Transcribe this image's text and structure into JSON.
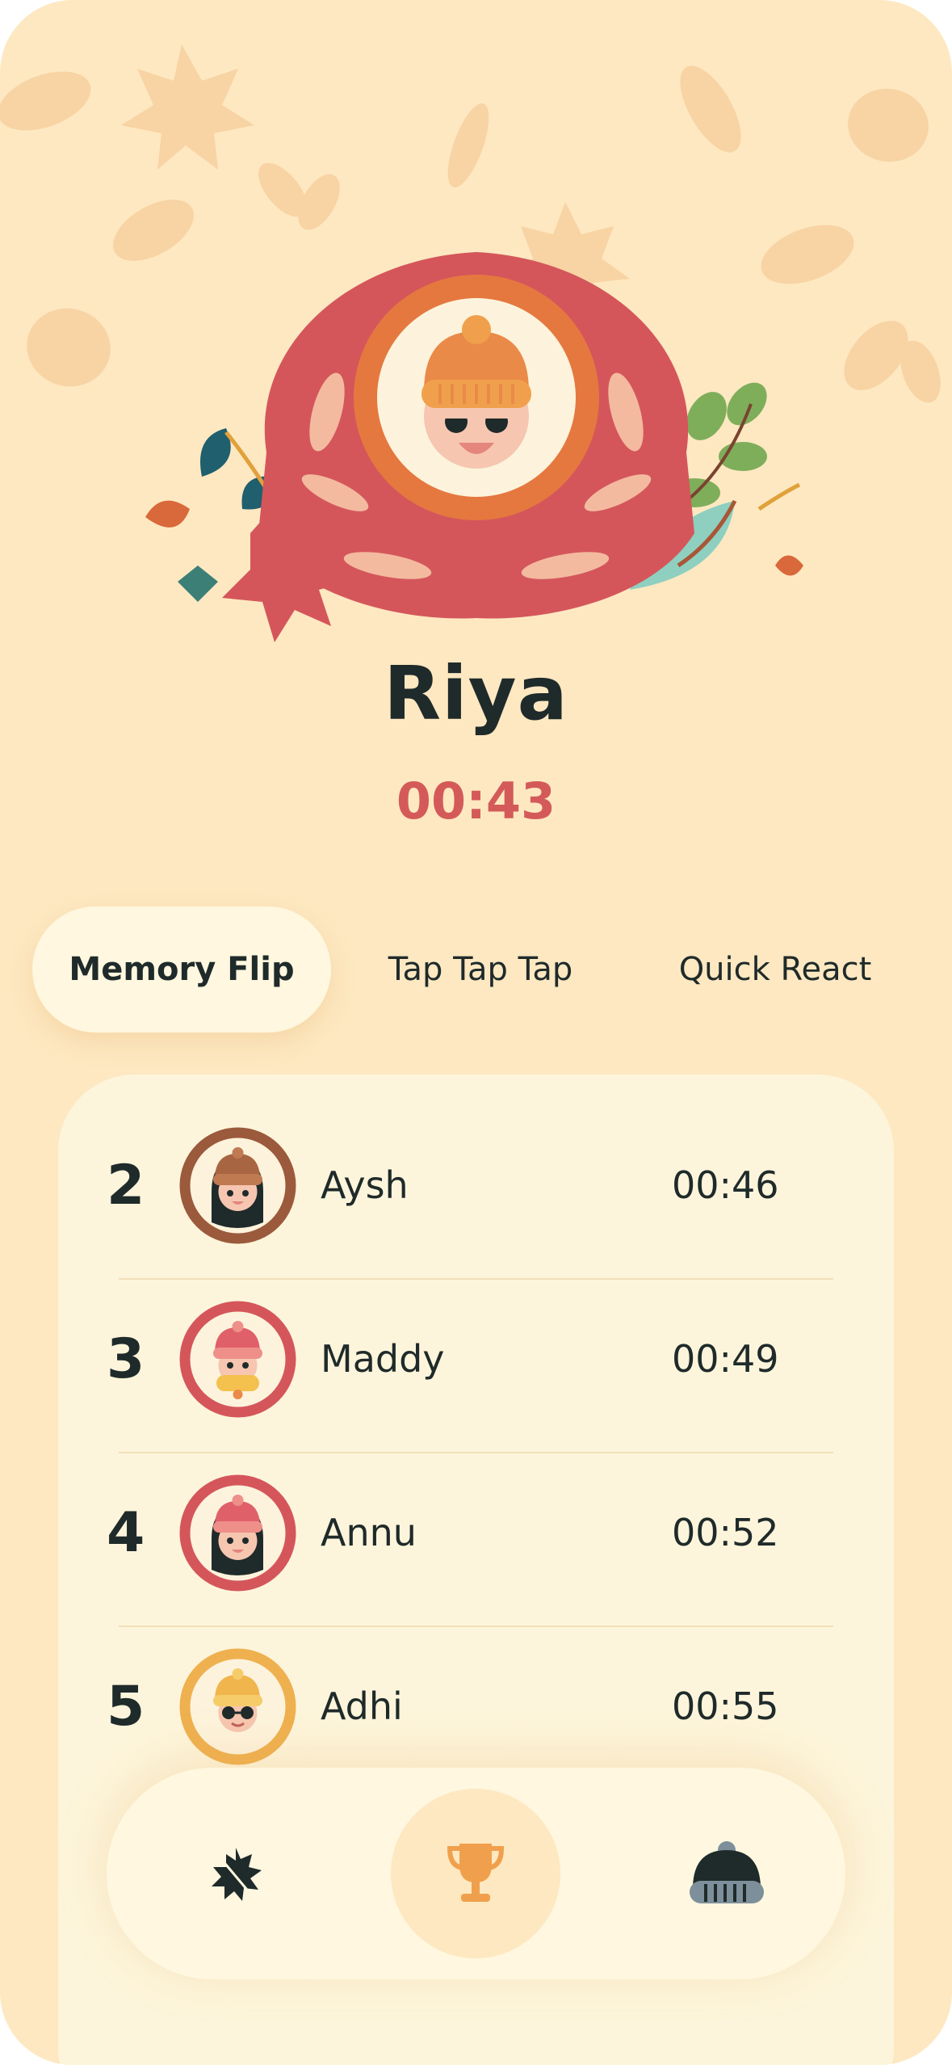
{
  "winner": {
    "name": "Riya",
    "time": "00:43"
  },
  "tabs": [
    {
      "label": "Memory Flip",
      "active": true
    },
    {
      "label": "Tap Tap Tap",
      "active": false
    },
    {
      "label": "Quick React",
      "active": false
    }
  ],
  "leaderboard": [
    {
      "rank": "2",
      "name": "Aysh",
      "time": "00:46",
      "ring_color": "#9b5a3c"
    },
    {
      "rank": "3",
      "name": "Maddy",
      "time": "00:49",
      "ring_color": "#d4565b"
    },
    {
      "rank": "4",
      "name": "Annu",
      "time": "00:52",
      "ring_color": "#d4565b"
    },
    {
      "rank": "5",
      "name": "Adhi",
      "time": "00:55",
      "ring_color": "#efb04f"
    }
  ],
  "nav": {
    "items": [
      {
        "icon": "leaf-icon"
      },
      {
        "icon": "trophy-icon",
        "active": true
      },
      {
        "icon": "beanie-icon"
      }
    ]
  },
  "colors": {
    "background": "#fde8c1",
    "accent_red": "#d4565b",
    "accent_orange": "#e5783f",
    "text_dark": "#1f2a2a",
    "card": "#fdf5db"
  }
}
